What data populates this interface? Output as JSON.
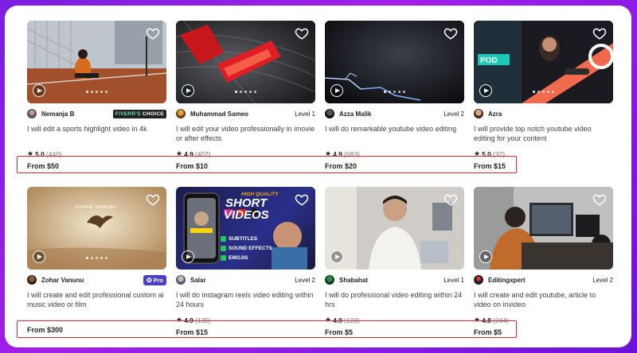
{
  "gigs": [
    {
      "seller": "Nemanja B",
      "badge_type": "fc",
      "badge": "FIVERR'S CHOICE",
      "level": "",
      "title": "I will edit a sports highlight video in 4k",
      "rating": "5.0",
      "reviews": "(440)",
      "price": "From $50"
    },
    {
      "seller": "Muhammad Sameo",
      "badge_type": "",
      "badge": "",
      "level": "Level 1",
      "title": "I will edit your video professionally in imovie or after effects",
      "rating": "4.9",
      "reviews": "(407)",
      "price": "From $10"
    },
    {
      "seller": "Azza Malik",
      "badge_type": "",
      "badge": "",
      "level": "Level 2",
      "title": "I will do remarkable youtube video editing",
      "rating": "4.9",
      "reviews": "(683)",
      "price": "From $20"
    },
    {
      "seller": "Azra",
      "badge_type": "",
      "badge": "",
      "level": "",
      "title": "I will provide top notch youtube video editing for your content",
      "rating": "5.0",
      "reviews": "(32)",
      "price": "From $15"
    },
    {
      "seller": "Zohar Vanunu",
      "badge_type": "pro",
      "badge": "Pro",
      "level": "",
      "title": "I will create and edit professional custom ai music video or film",
      "rating": "",
      "reviews": "",
      "price": "From $300",
      "thumb_text": "ZOHAR VANUNU"
    },
    {
      "seller": "Salar",
      "badge_type": "",
      "badge": "",
      "level": "Level 2",
      "title": "I will do instagram reels video editing within 24 hours",
      "rating": "4.9",
      "reviews": "(135)",
      "price": "From $15",
      "thumb_lines": [
        "HIGH QUALITY",
        "SHORT",
        "VIDEOS",
        "SUBTITLES",
        "SOUND EFFECTS",
        "EMOJIS"
      ]
    },
    {
      "seller": "Shabahat",
      "badge_type": "",
      "badge": "",
      "level": "Level 1",
      "title": "I will do professional video editing within 24 hrs",
      "rating": "4.9",
      "reviews": "(123)",
      "price": "From $5"
    },
    {
      "seller": "Editingxpert",
      "badge_type": "",
      "badge": "",
      "level": "Level 2",
      "title": "I will create and edit youtube, article to video on invideo",
      "rating": "4.8",
      "reviews": "(244)",
      "price": "From $5"
    }
  ],
  "colors": {
    "highlight": "#e0262b",
    "background": "#8a1ae6"
  }
}
